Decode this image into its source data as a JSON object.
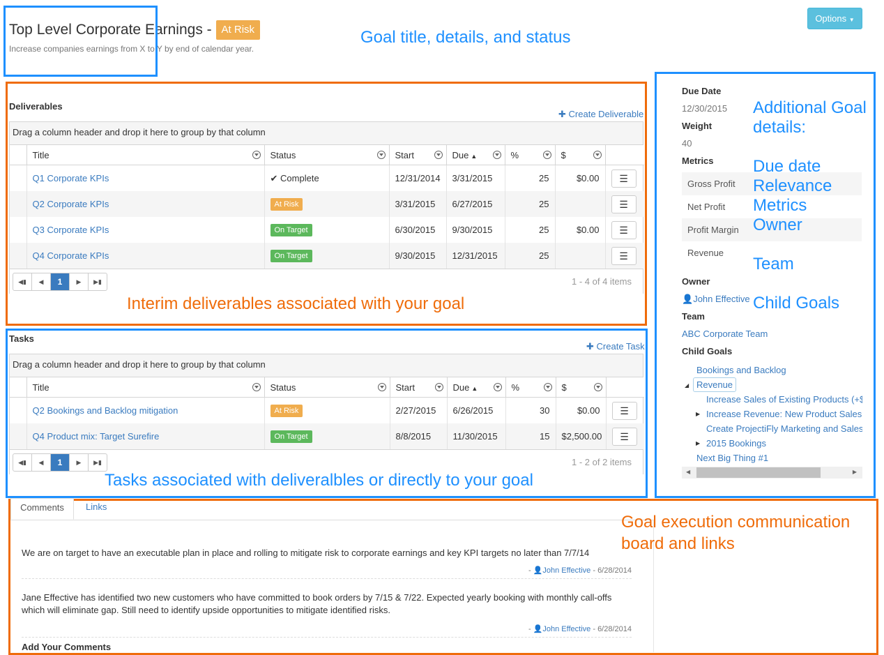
{
  "header": {
    "title": "Top Level Corporate Earnings -",
    "status": "At Risk",
    "subtitle": "Increase companies earnings from X to Y by end of calendar year.",
    "options_label": "Options"
  },
  "annotations": {
    "goal_title": "Goal title, details, and status",
    "additional_details": [
      "Additional Goal",
      "details:",
      "",
      "Due date",
      "Relevance",
      "Metrics",
      "Owner",
      "",
      "Team",
      "",
      "Child Goals"
    ],
    "deliverables": "Interim deliverables associated with your goal",
    "tasks": "Tasks associated with deliveralbles or directly to your goal",
    "comm_board": [
      "Goal execution communication",
      "board and links"
    ]
  },
  "deliverables": {
    "section_title": "Deliverables",
    "create_label": "Create Deliverable",
    "group_hint": "Drag a column header and drop it here to group by that column",
    "columns": [
      "Title",
      "Status",
      "Start",
      "Due",
      "%",
      "$"
    ],
    "rows": [
      {
        "title": "Q1 Corporate KPIs",
        "status": "Complete",
        "status_type": "complete",
        "start": "12/31/2014",
        "due": "3/31/2015",
        "pct": "25",
        "amount": "$0.00"
      },
      {
        "title": "Q2 Corporate KPIs",
        "status": "At Risk",
        "status_type": "risk",
        "start": "3/31/2015",
        "due": "6/27/2015",
        "pct": "25",
        "amount": ""
      },
      {
        "title": "Q3 Corporate KPIs",
        "status": "On Target",
        "status_type": "ok",
        "start": "6/30/2015",
        "due": "9/30/2015",
        "pct": "25",
        "amount": "$0.00"
      },
      {
        "title": "Q4 Corporate KPIs",
        "status": "On Target",
        "status_type": "ok",
        "start": "9/30/2015",
        "due": "12/31/2015",
        "pct": "25",
        "amount": ""
      }
    ],
    "page": "1",
    "pager_info": "1 - 4 of 4 items"
  },
  "tasks": {
    "section_title": "Tasks",
    "create_label": "Create Task",
    "group_hint": "Drag a column header and drop it here to group by that column",
    "columns": [
      "Title",
      "Status",
      "Start",
      "Due",
      "%",
      "$"
    ],
    "rows": [
      {
        "title": "Q2 Bookings and Backlog mitigation",
        "status": "At Risk",
        "status_type": "risk",
        "start": "2/27/2015",
        "due": "6/26/2015",
        "pct": "30",
        "amount": "$0.00"
      },
      {
        "title": "Q4 Product mix: Target Surefire",
        "status": "On Target",
        "status_type": "ok",
        "start": "8/8/2015",
        "due": "11/30/2015",
        "pct": "15",
        "amount": "$2,500.00"
      }
    ],
    "page": "1",
    "pager_info": "1 - 2 of 2 items"
  },
  "sidebar": {
    "due_date_label": "Due Date",
    "due_date": "12/30/2015",
    "weight_label": "Weight",
    "weight": "40",
    "metrics_label": "Metrics",
    "metrics": [
      "Gross Profit",
      "Net Profit",
      "Profit Margin",
      "Revenue"
    ],
    "owner_label": "Owner",
    "owner": "John Effective",
    "team_label": "Team",
    "team": "ABC Corporate Team",
    "child_goals_label": "Child Goals",
    "child_goals": [
      "Bookings and Backlog",
      "Revenue",
      "Increase Sales of Existing Products (+$",
      "Increase Revenue: New Product Sales",
      "Create ProjectiFly Marketing and Sales",
      "2015 Bookings",
      "Next Big Thing #1"
    ]
  },
  "comments": {
    "tabs": [
      "Comments",
      "Links"
    ],
    "items": [
      {
        "text": "We are on target to have an executable plan in place and rolling to mitigate risk to corporate earnings and key KPI targets no later than 7/7/14",
        "author": "John Effective",
        "date": "- 6/28/2014"
      },
      {
        "text": "Jane Effective has identified two new customers who have committed to book orders by 7/15 & 7/22. Expected yearly booking with monthly call-offs which will eliminate gap. Still need to identify upside opportunities to mitigate identified risks.",
        "author": "John Effective",
        "date": "- 6/28/2014"
      }
    ],
    "add_label": "Add Your Comments"
  },
  "colors": {
    "annotation_blue": "#1e90ff",
    "annotation_orange": "#ef6c0a",
    "link": "#3a7bbf",
    "at_risk": "#f0ad4e",
    "on_target": "#5cb85c",
    "options_button": "#5bc0de"
  }
}
